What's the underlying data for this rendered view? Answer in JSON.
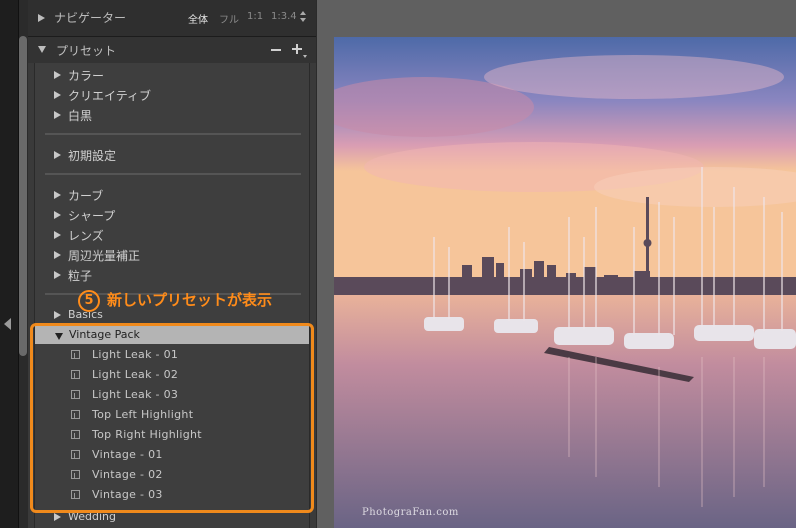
{
  "navigator": {
    "title": "ナビゲーター",
    "zoom_options": [
      "全体",
      "フル",
      "1:1",
      "1:3.4"
    ]
  },
  "presets": {
    "title": "プリセット",
    "remove_label": "−",
    "add_label": "+",
    "group1": [
      "カラー",
      "クリエイティブ",
      "白黒"
    ],
    "group2": [
      "初期設定"
    ],
    "group3": [
      "カーブ",
      "シャープ",
      "レンズ",
      "周辺光量補正",
      "粒子"
    ],
    "group4": [
      "Basics"
    ],
    "selected_folder": "Vintage Pack",
    "vintage_items": [
      "Light Leak - 01",
      "Light Leak - 02",
      "Light Leak - 03",
      "Top Left Highlight",
      "Top Right Highlight",
      "Vintage - 01",
      "Vintage - 02",
      "Vintage - 03"
    ],
    "next_folder": "Wedding"
  },
  "annotation": {
    "number": "5",
    "text": "新しいプリセットが表示"
  },
  "photo": {
    "watermark": "PhotograFan.com"
  },
  "colors": {
    "accent": "#f08a1c",
    "selected_row": "#b4b4b4",
    "panel_bg": "#3a3a3a"
  }
}
